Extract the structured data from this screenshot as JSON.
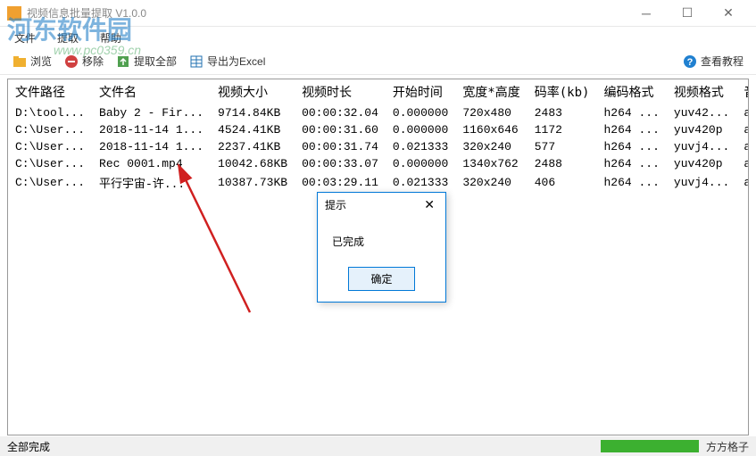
{
  "window": {
    "title": "视频信息批量提取    V1.0.0"
  },
  "menu": {
    "file": "文件",
    "extract": "提取",
    "help": "帮助"
  },
  "toolbar": {
    "browse": "浏览",
    "remove": "移除",
    "extract_all": "提取全部",
    "export_excel": "导出为Excel",
    "tutorial": "查看教程"
  },
  "columns": {
    "path": "文件路径",
    "name": "文件名",
    "size": "视频大小",
    "duration": "视频时长",
    "start": "开始时间",
    "wh": "宽度*高度",
    "bitrate": "码率(kb)",
    "vcodec": "编码格式",
    "vformat": "视频格式",
    "audio": "音频"
  },
  "rows": [
    {
      "path": "D:\\tool...",
      "name": "Baby 2 - Fir...",
      "size": "9714.84KB",
      "duration": "00:00:32.04",
      "start": "0.000000",
      "wh": "720x480",
      "bitrate": "2483",
      "vcodec": "h264 ...",
      "vformat": "yuv42...",
      "audio": "aac"
    },
    {
      "path": "C:\\User...",
      "name": "2018-11-14 1...",
      "size": "4524.41KB",
      "duration": "00:00:31.60",
      "start": "0.000000",
      "wh": "1160x646",
      "bitrate": "1172",
      "vcodec": "h264 ...",
      "vformat": "yuv420p",
      "audio": "aac"
    },
    {
      "path": "C:\\User...",
      "name": "2018-11-14 1...",
      "size": "2237.41KB",
      "duration": "00:00:31.74",
      "start": "0.021333",
      "wh": "320x240",
      "bitrate": "577",
      "vcodec": "h264 ...",
      "vformat": "yuvj4...",
      "audio": "aac"
    },
    {
      "path": "C:\\User...",
      "name": "Rec 0001.mp4",
      "size": "10042.68KB",
      "duration": "00:00:33.07",
      "start": "0.000000",
      "wh": "1340x762",
      "bitrate": "2488",
      "vcodec": "h264 ...",
      "vformat": "yuv420p",
      "audio": "aac"
    },
    {
      "path": "C:\\User...",
      "name": "平行宇宙-许...",
      "size": "10387.73KB",
      "duration": "00:03:29.11",
      "start": "0.021333",
      "wh": "320x240",
      "bitrate": "406",
      "vcodec": "h264 ...",
      "vformat": "yuvj4...",
      "audio": "aac"
    }
  ],
  "dialog": {
    "title": "提示",
    "message": "已完成",
    "ok": "确定"
  },
  "status": {
    "text": "全部完成",
    "brand": "方方格子"
  },
  "watermark": {
    "main": "河东软件园",
    "url": "www.pc0359.cn"
  },
  "icons": {
    "browse_color": "#f0b030",
    "remove_color": "#d04040",
    "extract_color": "#50a050",
    "excel_color": "#2070b0",
    "help_color": "#2080d0"
  }
}
